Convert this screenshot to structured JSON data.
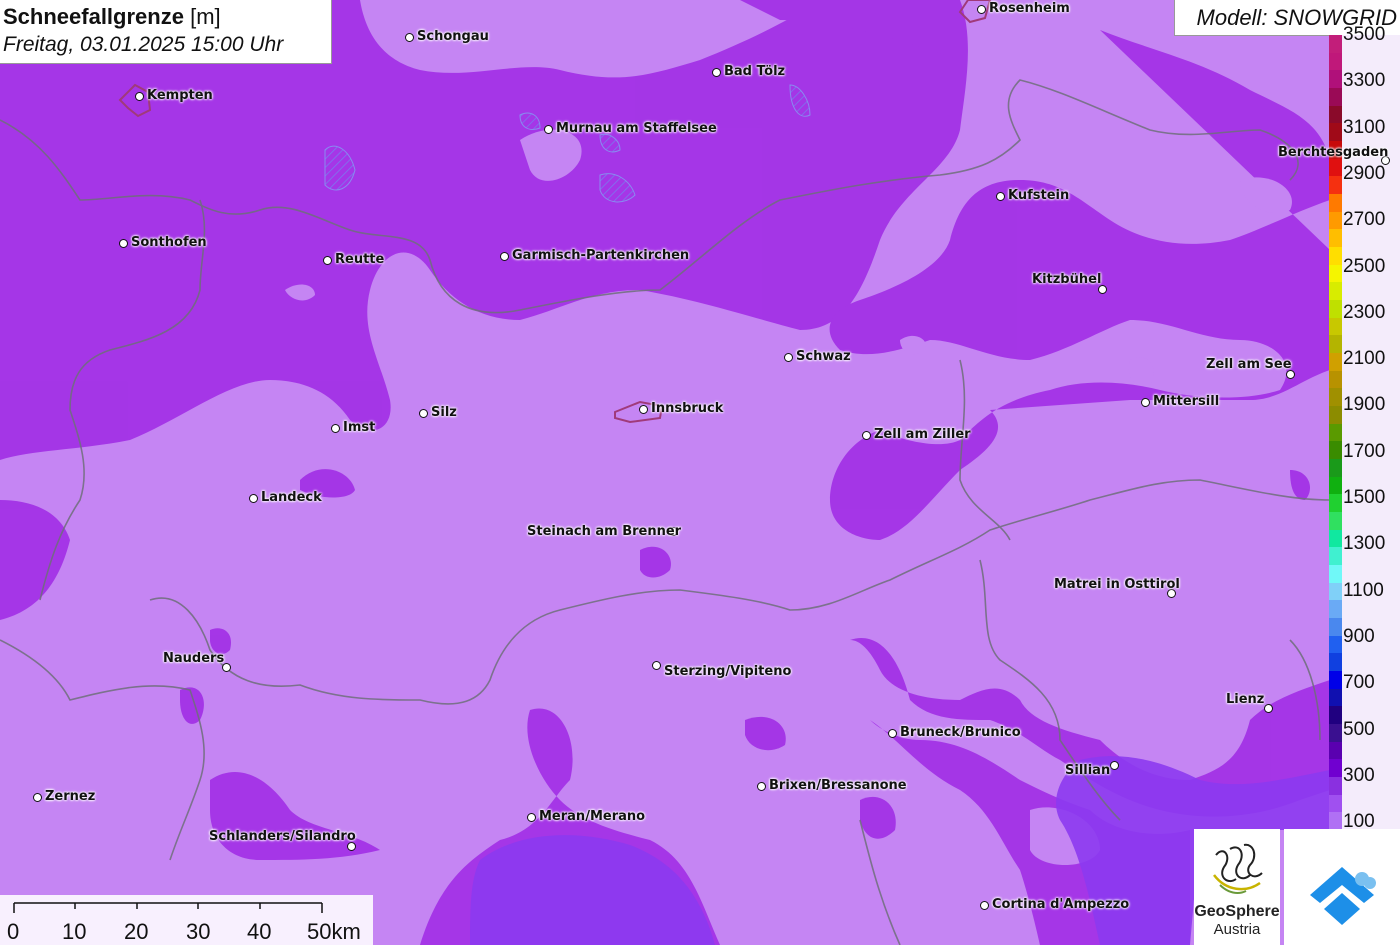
{
  "header": {
    "title_bold": "Schneefallgrenze",
    "title_unit": "[m]",
    "subtitle": "Freitag, 03.01.2025 15:00 Uhr"
  },
  "model_label": "Modell: SNOWGRID",
  "legend": {
    "labels": [
      "3500",
      "3300",
      "3100",
      "2900",
      "2700",
      "2500",
      "2300",
      "2100",
      "1900",
      "1700",
      "1500",
      "1300",
      "1100",
      "900",
      "700",
      "500",
      "300",
      "100"
    ],
    "colors": [
      "#c21e7a",
      "#c0187a",
      "#b0107a",
      "#9a0a56",
      "#8a0a2a",
      "#a00a18",
      "#c80a0a",
      "#e01010",
      "#f53010",
      "#ff7a00",
      "#ff9a00",
      "#ffbe00",
      "#ffde00",
      "#f5f500",
      "#d8ec00",
      "#bfe000",
      "#c8c800",
      "#b4b400",
      "#d0a000",
      "#b89200",
      "#a09000",
      "#8c8c00",
      "#5a9a00",
      "#3a8c00",
      "#1a9a1a",
      "#10b010",
      "#20d030",
      "#30e060",
      "#10e8a0",
      "#40f0d0",
      "#70f8f8",
      "#80d0f8",
      "#6aaaf5",
      "#4a88ee",
      "#2060f0",
      "#1040e0",
      "#0000e8",
      "#1010b0",
      "#200080",
      "#3a1090",
      "#5a00b0",
      "#7000d0",
      "#8a30e0",
      "#a050f0",
      "#b070f4"
    ]
  },
  "scale_bar": {
    "labels": [
      "0",
      "10",
      "20",
      "30",
      "40",
      "50km"
    ]
  },
  "logos": {
    "geosphere_line1": "GeoSphere",
    "geosphere_line2": "Austria"
  },
  "cities": [
    {
      "name": "Rosenheim"
    },
    {
      "name": "Schongau"
    },
    {
      "name": "Kempten"
    },
    {
      "name": "Bad Tölz"
    },
    {
      "name": "Murnau am Staffelsee"
    },
    {
      "name": "Berchtesgaden"
    },
    {
      "name": "Kufstein"
    },
    {
      "name": "Sonthofen"
    },
    {
      "name": "Reutte"
    },
    {
      "name": "Garmisch-Partenkirchen"
    },
    {
      "name": "Kitzbühel"
    },
    {
      "name": "Schwaz"
    },
    {
      "name": "Zell am See"
    },
    {
      "name": "Imst"
    },
    {
      "name": "Silz"
    },
    {
      "name": "Innsbruck"
    },
    {
      "name": "Mittersill"
    },
    {
      "name": "Zell am Ziller"
    },
    {
      "name": "Landeck"
    },
    {
      "name": "Steinach am Brenner"
    },
    {
      "name": "Matrei in Osttirol"
    },
    {
      "name": "Nauders"
    },
    {
      "name": "Sterzing/Vipiteno"
    },
    {
      "name": "Lienz"
    },
    {
      "name": "Bruneck/Brunico"
    },
    {
      "name": "Sillian"
    },
    {
      "name": "Zernez"
    },
    {
      "name": "Brixen/Bressanone"
    },
    {
      "name": "Meran/Merano"
    },
    {
      "name": "Schlanders/Silandro"
    },
    {
      "name": "Cortina d'Ampezzo"
    }
  ]
}
